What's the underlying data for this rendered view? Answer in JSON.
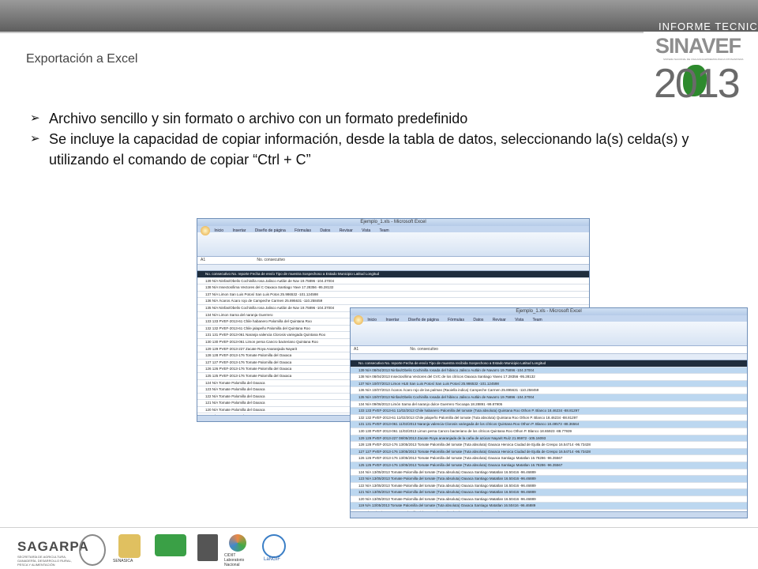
{
  "header": {
    "slide_title": "Exportación a Excel",
    "logo": {
      "top_text": "INFORME TECNICO",
      "name": "SINAVEF",
      "subtext": "SISTEMA NACIONAL DE VIGILANCIA EPIDEMIOLÓGICA FITOSANITARIA",
      "year": "2013"
    }
  },
  "bullets": [
    "Archivo sencillo y sin formato o archivo con un formato predefinido",
    "Se incluye la capacidad de copiar información, desde la tabla de datos, seleccionando la(s) celda(s) y utilizando el comando de copiar “Ctrl + C”"
  ],
  "excel_back": {
    "title": "Ejemplo_1.xls - Microsoft Excel",
    "tabs": [
      "Inicio",
      "Insertar",
      "Diseño de página",
      "Fórmulas",
      "Datos",
      "Revisar",
      "Vista",
      "Team"
    ],
    "cell_ref": "A1",
    "formula": "No. consecutivo",
    "rows": [
      "No. consecutivo   No. reporte   Fecha de envío   Tipo de muestra   Sospechoso a   Estado   Municipio   Latitud   Longitud",
      "139 N/A   Ninfas/Obelis   Cochinilla rosa   Jalisco   Autlán de Nav   19.75896   -104.37004",
      "138 N/A   Insectos/lima   Vectores del C   Oaxaca   Santiago Yave   17.28356   -95.28132",
      "137 N/A   Limon   San Luis Potosí   San Luis Potos   25.986532   -101.124598",
      "136 N/A   Ácaros   Ácaro rojo de   Campeche   Carmen   25.895631   -110.258459",
      "135 N/A   Ninfas/Obelis   Cochinilla rosa   Jalisco   Autlán de Nav   19.75896   -104.37004",
      "134 N/A   Limon   Sarna del naranja   Guerrero",
      "133 133 PVEF-2013-61   Chile habanero   Palomilla del   Quintana Roo",
      "132 132 PVEF-2013-61   Chile jalapeño   Palomilla del   Quintana Roo",
      "131 131 PVEF-2013-061   Naranja valencia   Clorosis variegada   Quintana Roo",
      "130 130 PVEF-2013-061   Limon persa   Cancro bacteriano   Quintana Roo",
      "129 129 PVEF-2013-227   Zacate   Roya Anaranjada   Nayarit",
      "128 128 PVEF-2013-176   Tomate   Palomilla del   Oaxaca",
      "127 127 PVEF-2013-176   Tomate   Palomilla del   Oaxaca",
      "126 126 PVEF-2013-176   Tomate   Palomilla del   Oaxaca",
      "125 125 PVEF-2013-176   Tomate   Palomilla del   Oaxaca",
      "124 N/A   Tomate   Palomilla del   Oaxaca",
      "123 N/A   Tomate   Palomilla del   Oaxaca",
      "122 N/A   Tomate   Palomilla del   Oaxaca",
      "121 N/A   Tomate   Palomilla del   Oaxaca",
      "120 N/A   Tomate   Palomilla del   Oaxaca",
      "119 N/A   Tomate   Sospechosos   Oaxaca",
      "118 N/A   Tomate   Palomilla del   Oaxaca",
      "117 N/A   Tomate   Palomilla del   Oaxaca",
      "116 N/A   Tomate   Palomilla del   Oaxaca",
      "115 115 PVEF-2013-176   Tomate   Palomilla del   Oaxaca"
    ]
  },
  "excel_front": {
    "title": "Ejemplo_1.xls - Microsoft Excel",
    "tabs": [
      "Inicio",
      "Insertar",
      "Diseño de página",
      "Fórmulas",
      "Datos",
      "Revisar",
      "Vista",
      "Team"
    ],
    "cell_ref": "A1",
    "formula": "No. consecutivo",
    "rows": [
      "No. consecutivo   No. reporte   Fecha de envío   Tipo de muestra recibida   Sospechoso a   Estado   Municipio   Latitud   Longitud",
      "139 N/A   08/04/2013 Ninfas/Obelis   Cochinilla rosada del hibisco   Jalisco   Autlán de Navarro   19.75896   -104.37004",
      "138 N/A   08/04/2013 Insectos/lima   Vectores del CVC de los cítricos   Oaxaca   Santiago Yaveo   17.28356   -95.28132",
      "137 N/A   10/07/2013 Limon   HLB   San Luis Potosí   San Luis Potosí   25.986532   -101.124598",
      "136 N/A   10/07/2013 Ácaros   Ácaro rojo de las palmas (Raoiella indica)   Campeche   Carmen   25.895631   -110.258459",
      "135 N/A   10/07/2013 Ninfas/Obelis   Cochinilla rosada del hibisco   Jalisco   Autlán de Navarro   19.75896   -104.37004",
      "134 N/A   09/06/2013 Limón   Sarna del naranjo dulce   Guerrero   Tixcoapa   18.28891   -99.87905",
      "133 133 PVEF-2013-61   11/02/2013 Chile habanero   Palomilla del tomate (Tuta absoluta)   Quintana Roo   Othon P. Blanco   18.46234   -88.81297",
      "132 132 PVEF-2013-61   11/02/2013 Chile jalapeño   Palomilla del tomate (Tuta absoluta)   Quintana Roo   Othon P. Blanco   18.46234   -88.81297",
      "131 131 PVEF-2013-061   11/02/2013 Naranja valencia   Clorosis variegada de los cítricos   Quintana Roo   Othon P. Blanco   18.49573   -88.36564",
      "130 130 PVEF-2013-061   11/02/2013 Limon persa   Cancro bacteriano de los cítricos   Quintana Roo   Othon P. Blanco   18.65923   -88.77939",
      "129 129 PVEF-2013-227   08/05/2013 Zacate   Roya anaranjada de la caña de azúcar   Nayarit   Ruíz   21.95972   -105.16093",
      "128 128 PVEF-2013-176   13/05/2013 Tomate   Palomilla del tomate (Tuta absoluta)   Oaxaca   Heroica Ciudad de Ejutla de Crespo   16.54714   -96.73428",
      "127 127 PVEF-2013-176   13/05/2013 Tomate   Palomilla del tomate (Tuta absoluta)   Oaxaca   Heroica Ciudad de Ejutla de Crespo   16.54714   -96.73428",
      "126 126 PVEF-2013-176   13/05/2013 Tomate   Palomilla del tomate (Tuta absoluta)   Oaxaca   Santiago Matatlan   16.78286   -96.35567",
      "125 125 PVEF-2013-176   13/05/2013 Tomate   Palomilla del tomate (Tuta absoluta)   Oaxaca   Santiago Matatlan   16.78286   -96.35567",
      "124 N/A   13/05/2013 Tomate   Palomilla del tomate (Tuta absoluta)   Oaxaca   Santiago Matatlan   16.50416   -96.46889",
      "123 N/A   13/05/2013 Tomate   Palomilla del tomate (Tuta absoluta)   Oaxaca   Santiago Matatlan   16.50416   -96.46889",
      "122 N/A   13/05/2013 Tomate   Palomilla del tomate (Tuta absoluta)   Oaxaca   Santiago Matatlan   16.50416   -96.46889",
      "121 N/A   13/05/2013 Tomate   Palomilla del tomate (Tuta absoluta)   Oaxaca   Santiago Matatlan   16.50416   -96.46889",
      "120 N/A   13/05/2013 Tomate   Palomilla del tomate (Tuta absoluta)   Oaxaca   Santiago Matatlan   16.50416   -96.46889",
      "119 N/A   13/05/2013 Tomate   Palomilla del tomate (Tuta absoluta)   Oaxaca   Santiago Matatlan   16.50416   -96.46889",
      "118 N/A   13/05/2013 Tomate   Palomilla del tomate (Tuta absoluta)   Oaxaca   Santiago Matatlan   16.50416   -96.46889",
      "117 N/A   13/05/2013 Tomate   Palomilla del tomate (Tuta absoluta)   Oaxaca   Santiago Matatlan   16.50416   -96.46889",
      "116 N/A   13/05/2013 Tomate   Palomilla del tomate (Tuta absoluta)   Oaxaca   Santiago Matatlan   16.50416   -96.46889",
      "115 N/A   13/05/2013 Tomate   Palomilla del tomate (Tuta absoluta)   Oaxaca   Santiago Matatlan   16.50416   -96.46889"
    ]
  },
  "footer": {
    "sagarpa": "SAGARPA",
    "sagarpa_sub": "SECRETARÍA DE AGRICULTURA, GANADERÍA, DESARROLLO RURAL, PESCA Y ALIMENTACIÓN",
    "senasica": "SENASICA",
    "ciidit": "CIDIIT Laboratorio Nacional",
    "langif": "LaNGIF"
  },
  "colors": {
    "topbar": "#6e6e6e",
    "selected_row": "#bcd7f0",
    "header_row": "#1f2d3d"
  }
}
